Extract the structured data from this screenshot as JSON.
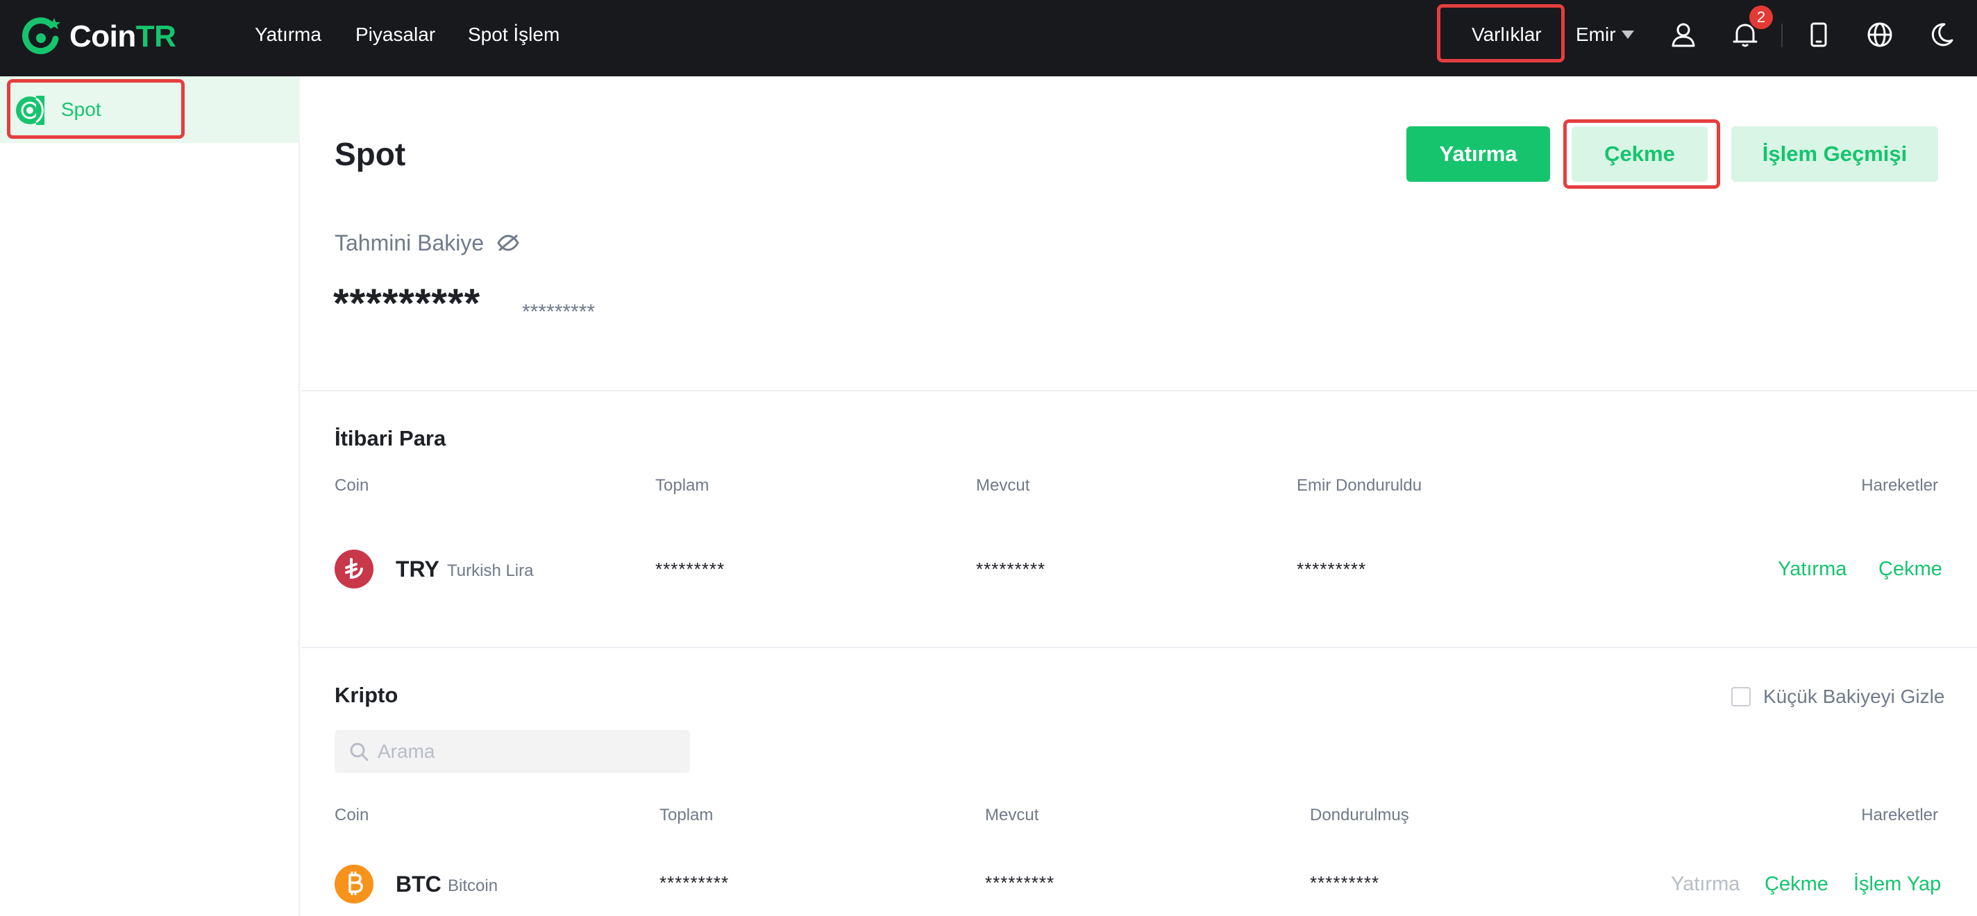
{
  "header": {
    "logo_left": "Coin",
    "logo_right": "TR",
    "nav": [
      "Yatırma",
      "Piyasalar",
      "Spot İşlem"
    ],
    "assets": "Varlıklar",
    "user": "Emir",
    "notification_count": "2"
  },
  "sidebar": {
    "items": [
      {
        "label": "Spot"
      }
    ]
  },
  "main": {
    "title": "Spot",
    "buttons": {
      "deposit": "Yatırma",
      "withdraw": "Çekme",
      "history": "İşlem Geçmişi"
    },
    "balance_label": "Tahmini Bakiye",
    "balance_value": "*********",
    "balance_sub": "*********"
  },
  "fiat": {
    "title": "İtibari Para",
    "columns": [
      "Coin",
      "Toplam",
      "Mevcut",
      "Emir Donduruldu",
      "Hareketler"
    ],
    "rows": [
      {
        "symbol": "TRY",
        "name": "Turkish Lira",
        "total": "*********",
        "available": "*********",
        "frozen": "*********",
        "actions": [
          "Yatırma",
          "Çekme"
        ]
      }
    ]
  },
  "crypto": {
    "title": "Kripto",
    "hide_small": "Küçük Bakiyeyi Gizle",
    "search_placeholder": "Arama",
    "columns": [
      "Coin",
      "Toplam",
      "Mevcut",
      "Dondurulmuş",
      "Hareketler"
    ],
    "rows": [
      {
        "symbol": "BTC",
        "name": "Bitcoin",
        "total": "*********",
        "available": "*********",
        "frozen": "*********",
        "actions": [
          "Yatırma",
          "Çekme",
          "İşlem Yap"
        ]
      }
    ]
  },
  "colors": {
    "accent": "#16c46e",
    "topbar": "#18191d",
    "highlight_border": "#e53e3e",
    "try_icon": "#c8374a",
    "btc_icon": "#f7931a"
  }
}
